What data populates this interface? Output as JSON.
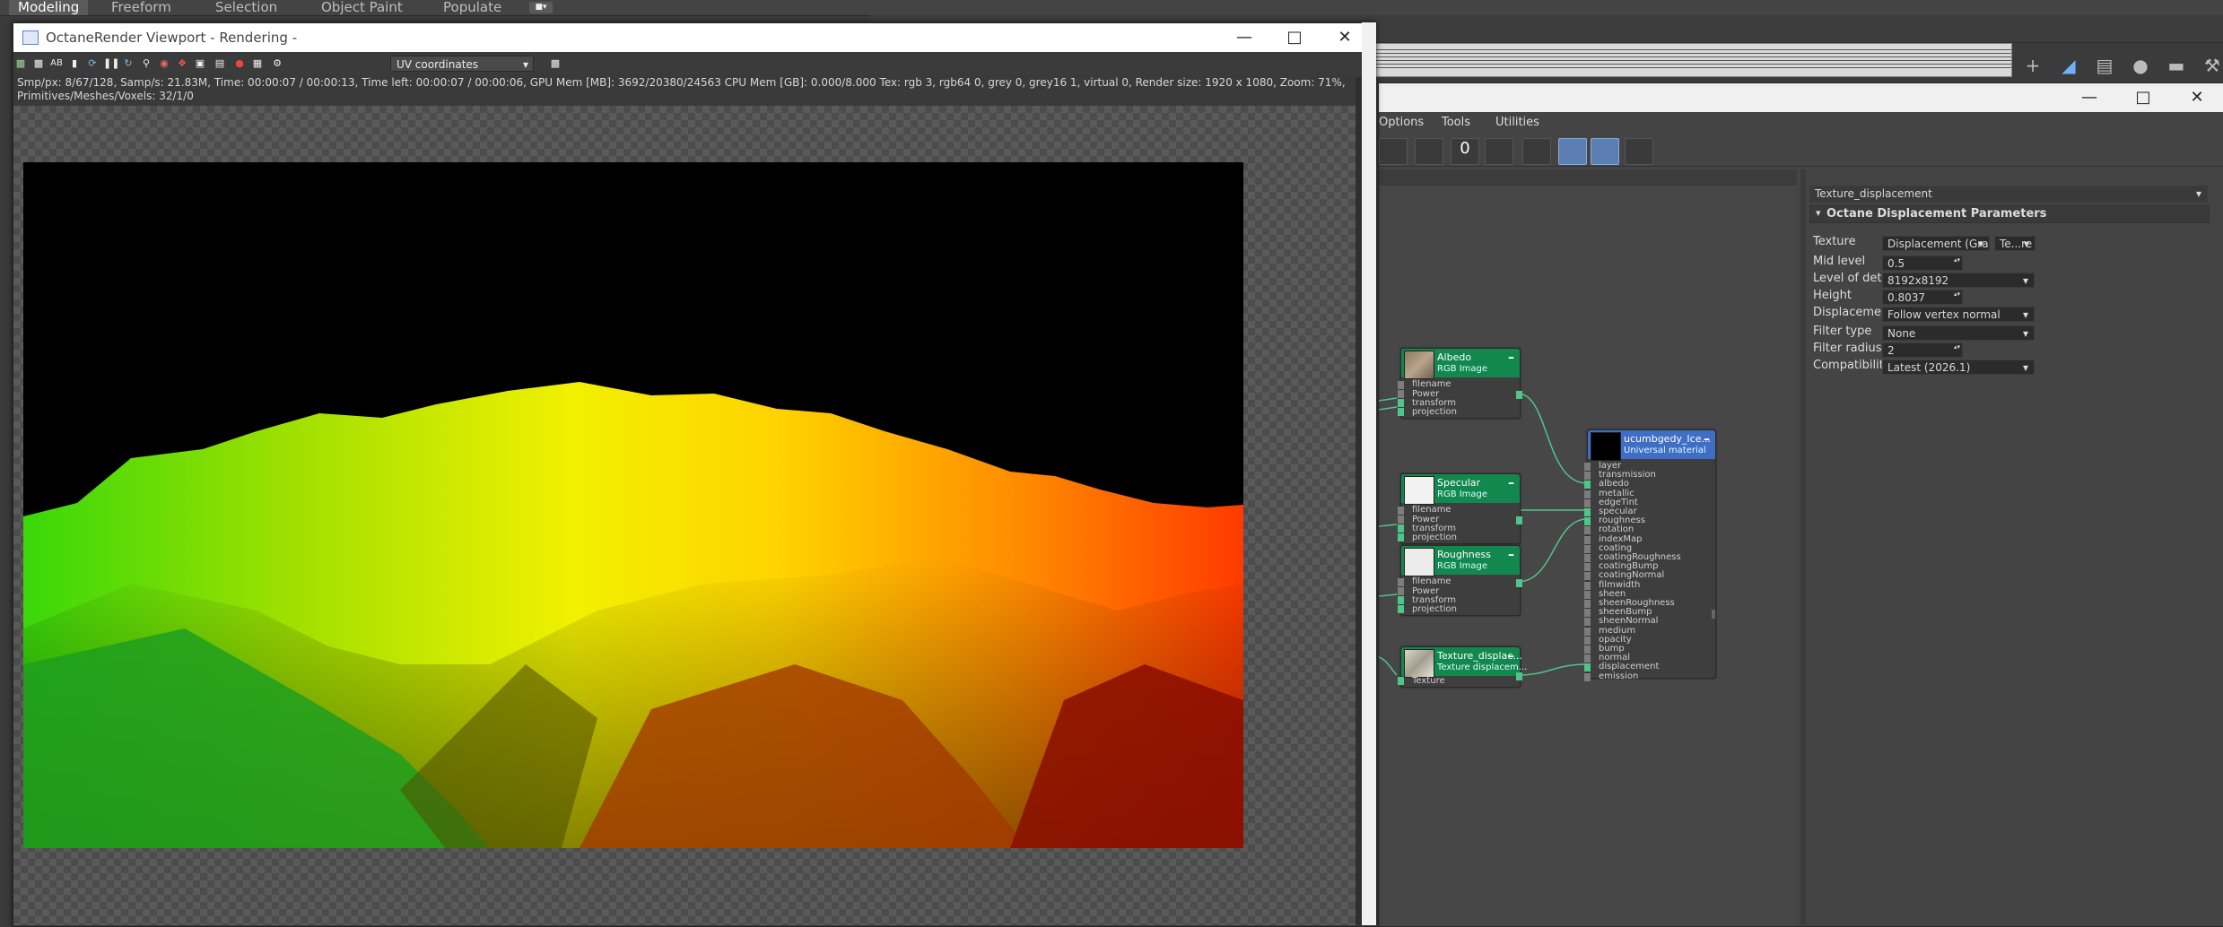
{
  "ribbon_tabs": [
    "Modeling",
    "Freeform",
    "Selection",
    "Object Paint",
    "Populate"
  ],
  "ribbon_dropdown_icon": "camera-dropdown-icon",
  "viewport": {
    "title": "OctaneRender Viewport - Rendering -",
    "kernel": "UV coordinates",
    "toolbar_text_ab": "AB",
    "stats_line1": "Smp/px: 8/67/128,   Samp/s: 21.83M,   Time: 00:00:07 / 00:00:13,   Time left: 00:00:07 / 00:00:06,   GPU Mem [MB]: 3692/20380/24563   CPU Mem [GB]: 0.000/8.000   Tex: rgb 3, rgb64 0, grey 0, grey16 1, virtual 0,   Render size: 1920 x 1080,   Zoom: 71%,",
    "stats_line2": "Primitives/Meshes/Voxels: 32/1/0",
    "colors": {
      "sky": "#000000",
      "yellow": "#ffff00",
      "green": "#22cc00",
      "red": "#cc2200"
    }
  },
  "material_editor": {
    "menus": [
      "Options",
      "Tools",
      "Utilities"
    ],
    "nodes": {
      "albedo": {
        "title": "Albedo",
        "sub": "RGB Image",
        "slots": [
          "filename",
          "Power",
          "transform",
          "projection"
        ]
      },
      "specular": {
        "title": "Specular",
        "sub": "RGB Image",
        "slots": [
          "filename",
          "Power",
          "transform",
          "projection"
        ]
      },
      "roughness": {
        "title": "Roughness",
        "sub": "RGB Image",
        "slots": [
          "filename",
          "Power",
          "transform",
          "projection"
        ]
      },
      "displacement": {
        "title": "Texture_displac...",
        "sub": "Texture displacem...",
        "slots": [
          "Texture"
        ]
      },
      "material": {
        "title": "ucumbgedy_Ice...",
        "sub": "Universal material",
        "slots": [
          "layer",
          "transmission",
          "albedo",
          "metallic",
          "edgeTint",
          "specular",
          "roughness",
          "rotation",
          "indexMap",
          "coating",
          "coatingRoughness",
          "coatingBump",
          "coatingNormal",
          "filmwidth",
          "sheen",
          "sheenRoughness",
          "sheenBump",
          "sheenNormal",
          "medium",
          "opacity",
          "bump",
          "normal",
          "displacement",
          "emission"
        ]
      }
    },
    "params": {
      "name": "Texture_displacement",
      "rollout": "Octane Displacement Parameters",
      "rows": [
        {
          "label": "Texture",
          "value": "Displacement (Grayscale image)",
          "extra": "Te...re"
        },
        {
          "label": "Mid level",
          "value": "0.5"
        },
        {
          "label": "Level of detail",
          "value": "8192x8192"
        },
        {
          "label": "Height",
          "value": "0.8037"
        },
        {
          "label": "Displacement direct...",
          "value": "Follow vertex normal"
        },
        {
          "label": "Filter type",
          "value": "None"
        },
        {
          "label": "Filter radius",
          "value": "2"
        },
        {
          "label": "Compatibility mode",
          "value": "Latest (2026.1)"
        }
      ]
    }
  }
}
